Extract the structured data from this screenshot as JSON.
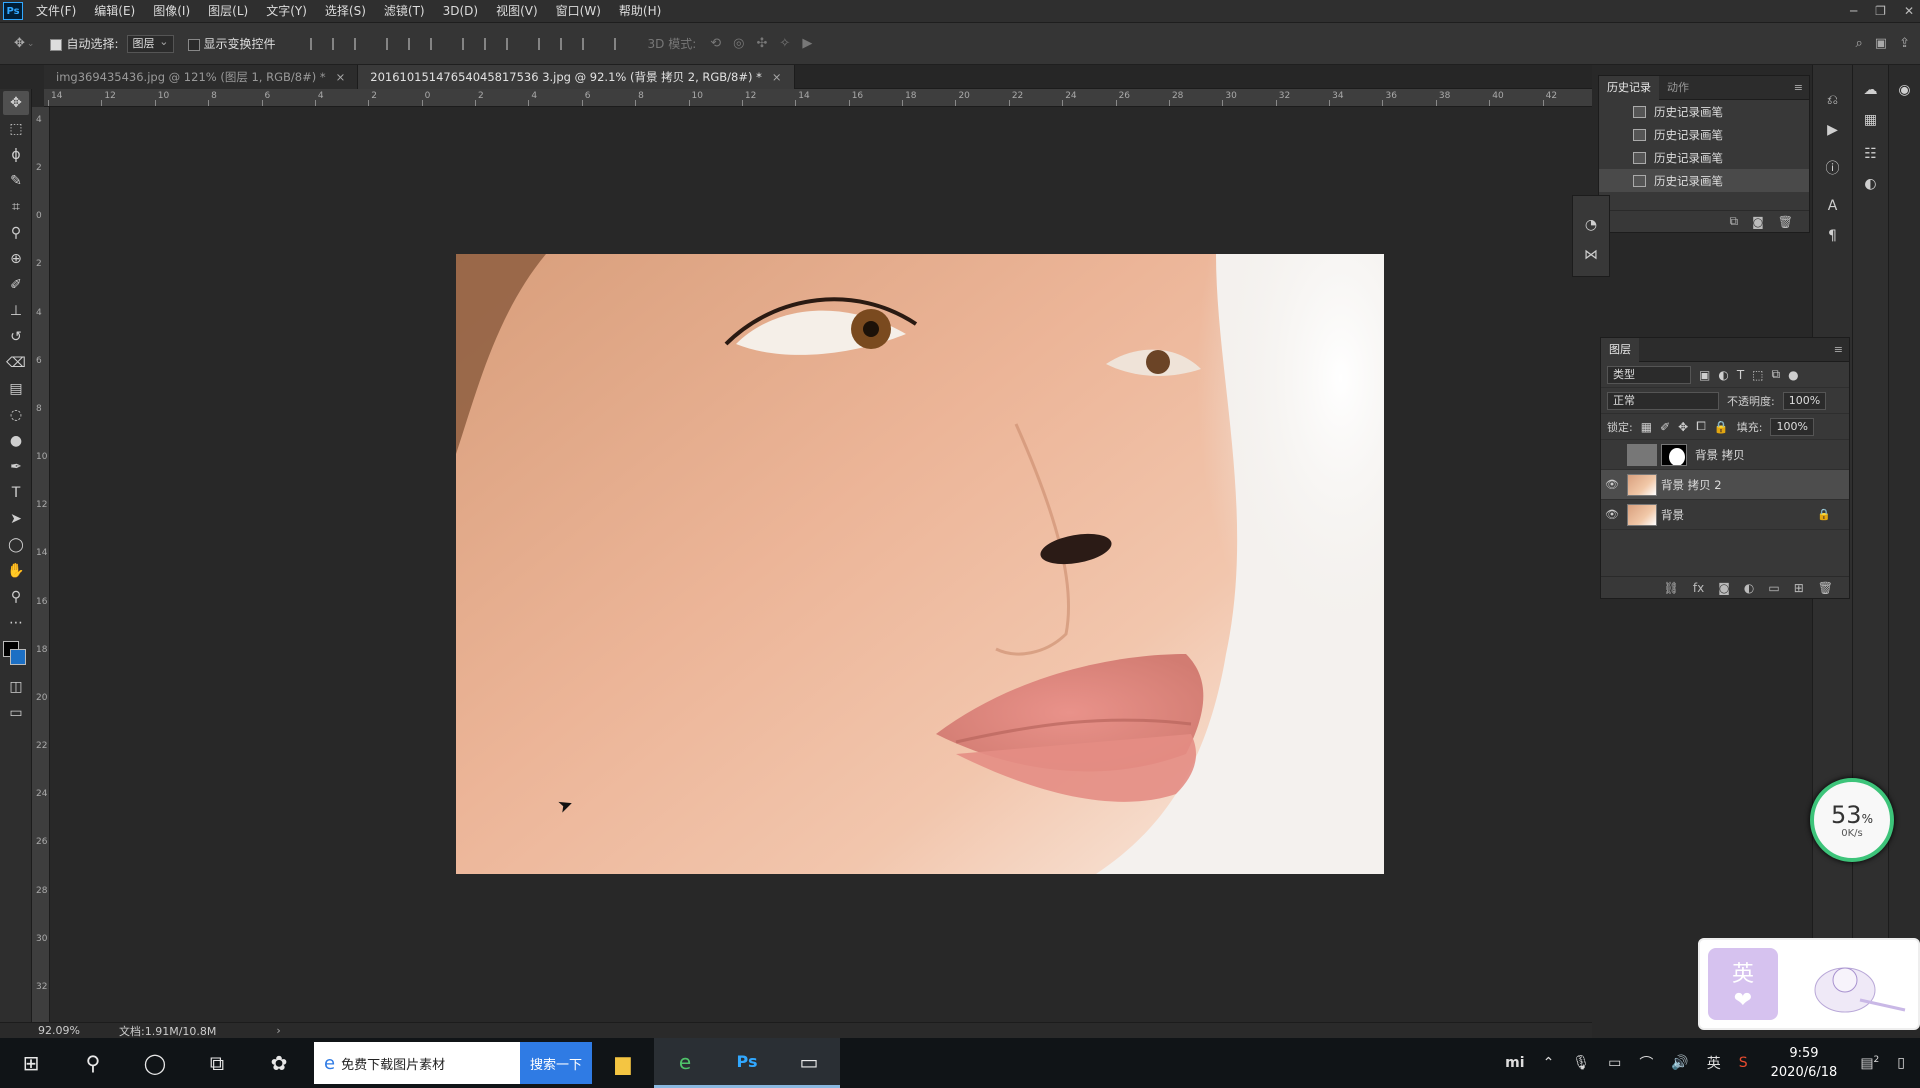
{
  "app": {
    "logo": "Ps"
  },
  "menu": [
    "文件(F)",
    "编辑(E)",
    "图像(I)",
    "图层(L)",
    "文字(Y)",
    "选择(S)",
    "滤镜(T)",
    "3D(D)",
    "视图(V)",
    "窗口(W)",
    "帮助(H)"
  ],
  "window_controls": {
    "minimize": "─",
    "restore": "❐",
    "close": "✕"
  },
  "options": {
    "auto_select_label": "自动选择:",
    "auto_select_value": "图层",
    "show_transform_label": "显示变换控件",
    "mode_3d_label": "3D 模式:"
  },
  "tabs": [
    {
      "label": "img369435436.jpg @ 121% (图层 1, RGB/8#) *",
      "close": "×"
    },
    {
      "label": "20161015147654045817536 3.jpg @ 92.1% (背景 拷贝 2, RGB/8#) *",
      "close": "×"
    }
  ],
  "ruler_top": [
    "14",
    "12",
    "10",
    "8",
    "6",
    "4",
    "2",
    "0",
    "2",
    "4",
    "6",
    "8",
    "10",
    "12",
    "14",
    "16",
    "18",
    "20",
    "22",
    "24",
    "26",
    "28",
    "30",
    "32",
    "34",
    "36",
    "38",
    "40",
    "42"
  ],
  "ruler_left": [
    "4",
    "2",
    "0",
    "2",
    "4",
    "6",
    "8",
    "10",
    "12",
    "14",
    "16",
    "18",
    "20",
    "22",
    "24",
    "26",
    "28",
    "30",
    "32"
  ],
  "status": {
    "zoom": "92.09%",
    "doc": "文档:1.91M/10.8M",
    "arrow": "›"
  },
  "history": {
    "tabs": [
      "历史记录",
      "动作"
    ],
    "items": [
      "历史记录画笔",
      "历史记录画笔",
      "历史记录画笔",
      "历史记录画笔"
    ]
  },
  "layers": {
    "title": "图层",
    "filter": "类型",
    "blend": "正常",
    "opacity_label": "不透明度:",
    "opacity": "100%",
    "lock_label": "锁定:",
    "fill_label": "填充:",
    "fill": "100%",
    "items": [
      {
        "name": "背景 拷贝",
        "visible": false,
        "masked": true,
        "locked": false
      },
      {
        "name": "背景 拷贝 2",
        "visible": true,
        "masked": false,
        "locked": false
      },
      {
        "name": "背景",
        "visible": true,
        "masked": false,
        "locked": true
      }
    ]
  },
  "network": {
    "percent": "53",
    "unit": "%",
    "speed": "0K/s"
  },
  "sticker": {
    "text1": "英",
    "text2": "❤"
  },
  "taskbar": {
    "search_text": "免费下载图片素材",
    "search_button": "搜索一下",
    "ime": "英",
    "time": "9:59",
    "date": "2020/6/18",
    "notif_count": "2"
  },
  "colors": {
    "accent": "#31a8ff",
    "foreground": "#000000",
    "background": "#1c6fc4",
    "network_ring": "#3dc47a"
  }
}
